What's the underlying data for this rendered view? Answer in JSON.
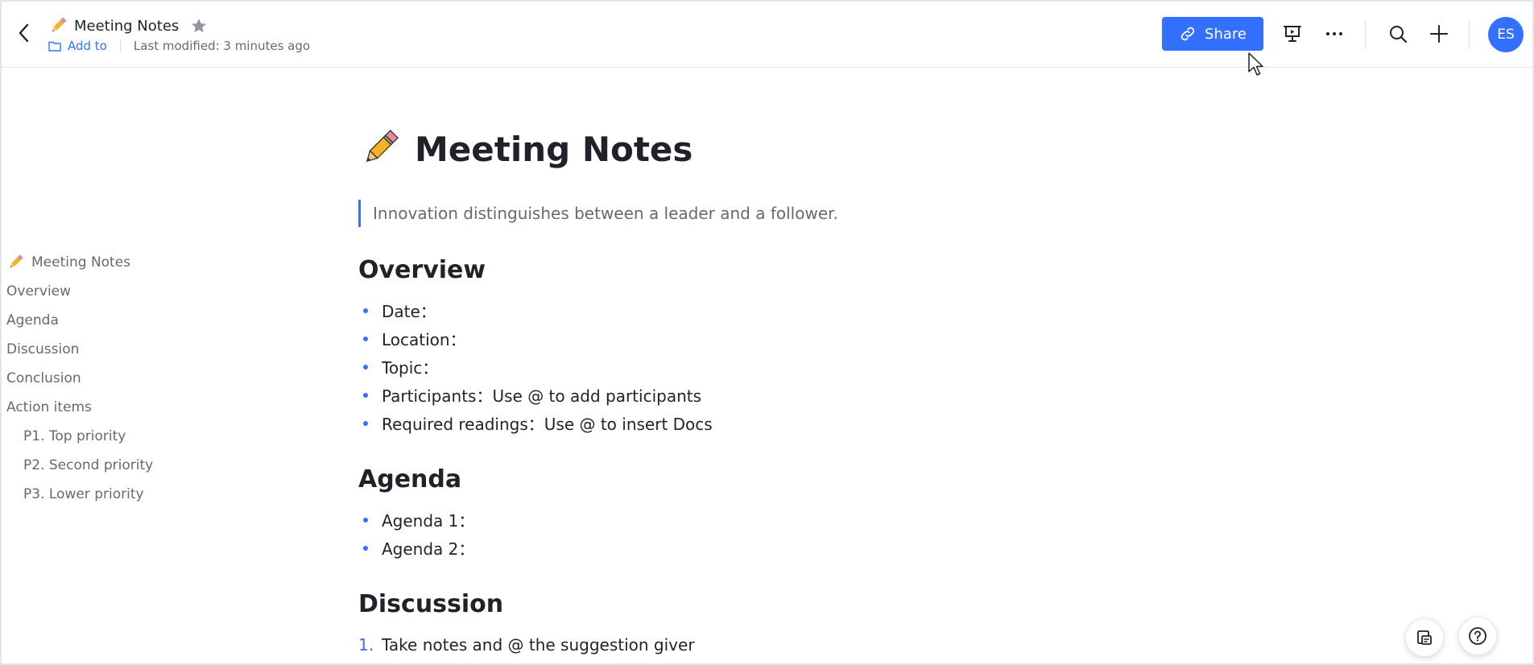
{
  "header": {
    "title": "Meeting Notes",
    "add_to_label": "Add to",
    "last_modified": "Last modified: 3 minutes ago",
    "share_label": "Share",
    "avatar_initials": "ES"
  },
  "outline": {
    "items": [
      {
        "label": "Meeting Notes",
        "level": 1,
        "icon": "pencil-icon"
      },
      {
        "label": "Overview",
        "level": 1
      },
      {
        "label": "Agenda",
        "level": 1
      },
      {
        "label": "Discussion",
        "level": 1
      },
      {
        "label": "Conclusion",
        "level": 1
      },
      {
        "label": "Action items",
        "level": 1
      },
      {
        "label": "P1. Top priority",
        "level": 2
      },
      {
        "label": "P2. Second priority",
        "level": 2
      },
      {
        "label": "P3. Lower priority",
        "level": 2
      }
    ]
  },
  "document": {
    "title": "Meeting Notes",
    "quote": "Innovation distinguishes between a leader and a follower.",
    "overview": {
      "heading": "Overview",
      "items": [
        "Date：",
        "Location：",
        "Topic：",
        "Participants：Use @ to add participants",
        "Required readings：Use @ to insert Docs"
      ]
    },
    "agenda": {
      "heading": "Agenda",
      "items": [
        "Agenda 1：",
        "Agenda 2："
      ]
    },
    "discussion": {
      "heading": "Discussion",
      "items": [
        {
          "num": "1.",
          "text": "Take notes and @ the suggestion giver"
        }
      ]
    }
  },
  "colors": {
    "accent": "#3370ff",
    "text": "#1f2329",
    "muted": "#646a73"
  }
}
